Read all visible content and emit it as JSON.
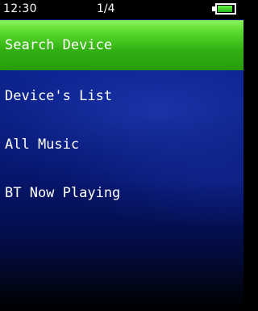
{
  "status_bar": {
    "time": "12:30",
    "page": "1/4",
    "battery_level": 0.9
  },
  "menu": {
    "selected_index": 0,
    "items": [
      {
        "label": "Search Device"
      },
      {
        "label": "Device's List"
      },
      {
        "label": "All Music"
      },
      {
        "label": "BT Now Playing"
      }
    ]
  },
  "colors": {
    "highlight": "#4ccb22",
    "background": "#0a1e86",
    "text": "#ffffff"
  }
}
